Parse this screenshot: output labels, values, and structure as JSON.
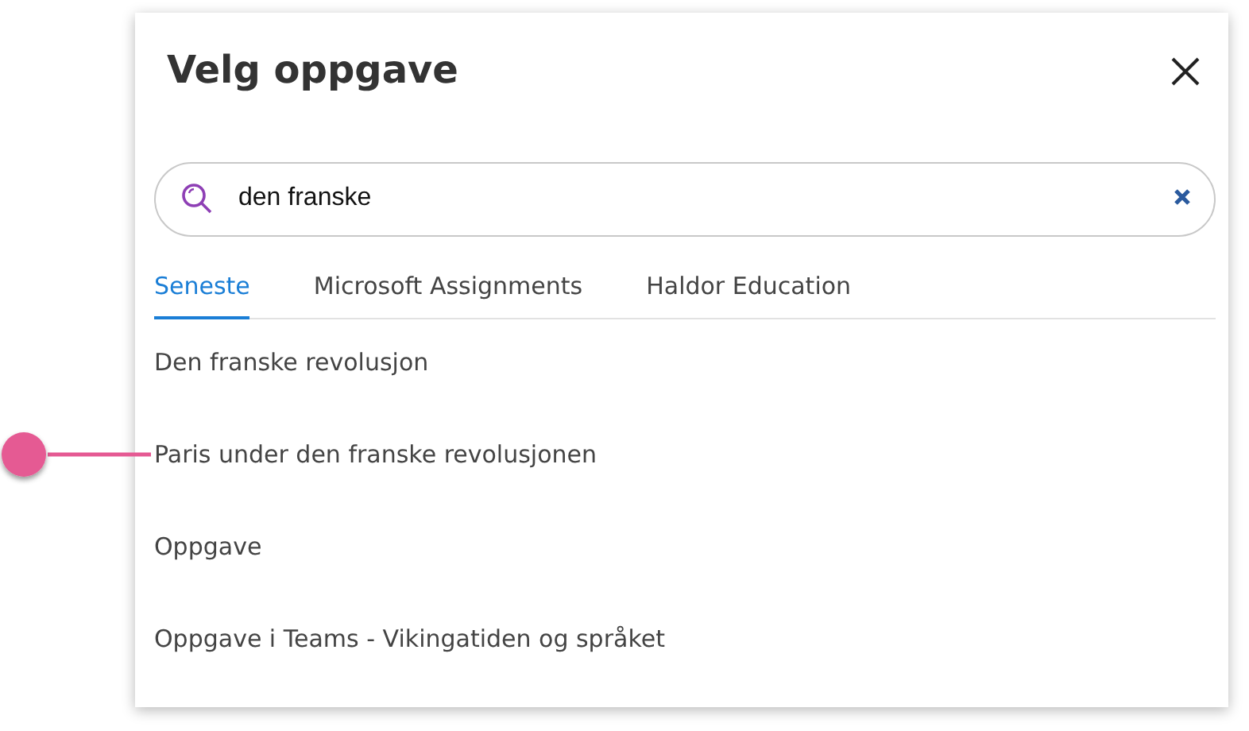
{
  "dialog": {
    "title": "Velg oppgave"
  },
  "search": {
    "value": "den franske"
  },
  "tabs": [
    {
      "label": "Seneste",
      "selected": true
    },
    {
      "label": "Microsoft Assignments",
      "selected": false
    },
    {
      "label": "Haldor Education",
      "selected": false
    }
  ],
  "results": [
    {
      "label": "Den franske revolusjon",
      "callout": false
    },
    {
      "label": "Paris under den franske revolusjonen",
      "callout": true
    },
    {
      "label": "Oppgave",
      "callout": false
    },
    {
      "label": "Oppgave i Teams - Vikingatiden og språket",
      "callout": false
    }
  ]
}
